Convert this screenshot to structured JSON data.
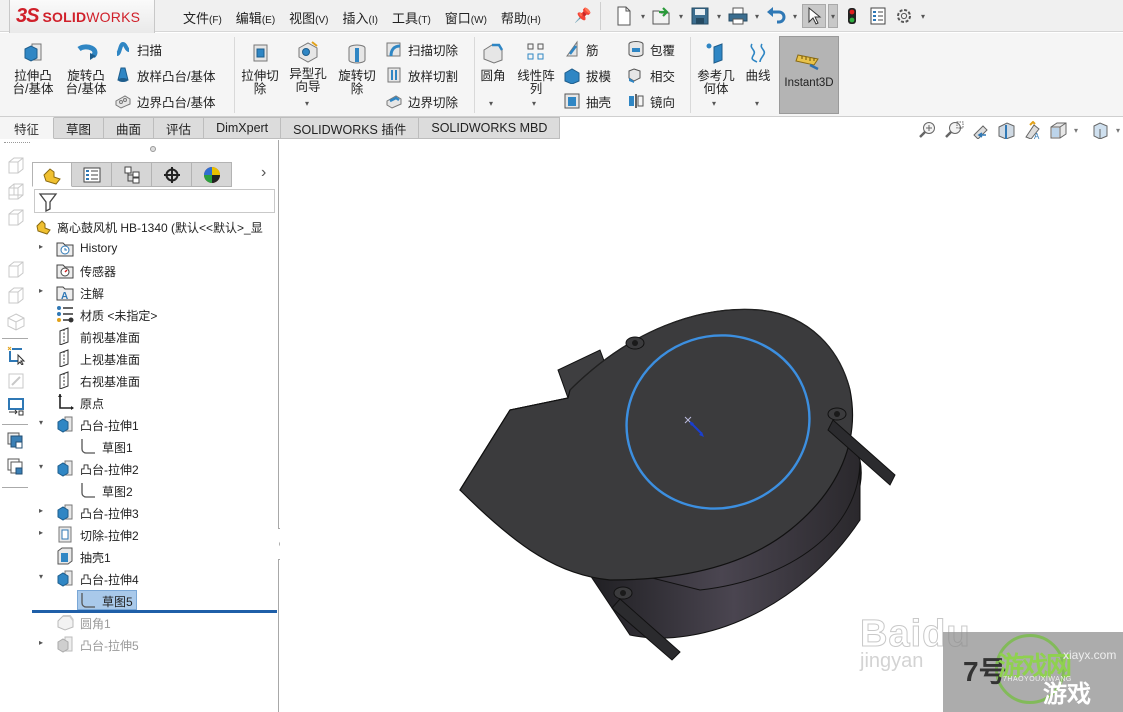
{
  "app": {
    "brand_mark": "3S",
    "brand_solid": "SOLID",
    "brand_works": "WORKS"
  },
  "menus": [
    {
      "label": "文件",
      "key": "(F)"
    },
    {
      "label": "编辑",
      "key": "(E)"
    },
    {
      "label": "视图",
      "key": "(V)"
    },
    {
      "label": "插入",
      "key": "(I)"
    },
    {
      "label": "工具",
      "key": "(T)"
    },
    {
      "label": "窗口",
      "key": "(W)"
    },
    {
      "label": "帮助",
      "key": "(H)"
    }
  ],
  "quick_access": [
    "new-document",
    "open",
    "save",
    "print",
    "undo",
    "select",
    "rebuild",
    "file-properties",
    "options"
  ],
  "commands": {
    "extrude_boss": [
      "拉伸凸",
      "台/基体"
    ],
    "revolve_boss": [
      "旋转凸",
      "台/基体"
    ],
    "sweep": "扫描",
    "loft_boss": "放样凸台/基体",
    "boundary_boss": "边界凸台/基体",
    "extrude_cut": [
      "拉伸切",
      "除"
    ],
    "hole_wizard": [
      "异型孔",
      "向导"
    ],
    "revolve_cut": [
      "旋转切",
      "除"
    ],
    "sweep_cut": "扫描切除",
    "loft_cut": "放样切割",
    "boundary_cut": "边界切除",
    "fillet": "圆角",
    "linear_pattern": [
      "线性阵",
      "列"
    ],
    "rib": "筋",
    "draft": "拔模",
    "shell": "抽壳",
    "wrap": "包覆",
    "intersect": "相交",
    "mirror": "镜向",
    "ref_geometry": [
      "参考几",
      "何体"
    ],
    "curves": "曲线",
    "instant3d": "Instant3D"
  },
  "tabs": [
    {
      "label": "特征",
      "active": true
    },
    {
      "label": "草图",
      "active": false
    },
    {
      "label": "曲面",
      "active": false
    },
    {
      "label": "评估",
      "active": false
    },
    {
      "label": "DimXpert",
      "active": false
    },
    {
      "label": "SOLIDWORKS 插件",
      "active": false
    },
    {
      "label": "SOLIDWORKS MBD",
      "active": false
    }
  ],
  "tree": {
    "root": "离心鼓风机 HB-1340  (默认<<默认>_显",
    "items": [
      {
        "label": "History",
        "expander": "collapsed",
        "icon": "history-folder"
      },
      {
        "label": "传感器",
        "expander": "none",
        "icon": "sensor-folder"
      },
      {
        "label": "注解",
        "expander": "collapsed",
        "icon": "annotation-folder"
      },
      {
        "label": "材质 <未指定>",
        "expander": "none",
        "icon": "material"
      },
      {
        "label": "前视基准面",
        "expander": "none",
        "icon": "plane"
      },
      {
        "label": "上视基准面",
        "expander": "none",
        "icon": "plane"
      },
      {
        "label": "右视基准面",
        "expander": "none",
        "icon": "plane"
      },
      {
        "label": "原点",
        "expander": "none",
        "icon": "origin"
      },
      {
        "label": "凸台-拉伸1",
        "expander": "expanded",
        "icon": "boss-extrude"
      },
      {
        "label": "草图1",
        "expander": "none",
        "icon": "sketch",
        "child": true
      },
      {
        "label": "凸台-拉伸2",
        "expander": "expanded",
        "icon": "boss-extrude"
      },
      {
        "label": "草图2",
        "expander": "none",
        "icon": "sketch",
        "child": true
      },
      {
        "label": "凸台-拉伸3",
        "expander": "collapsed",
        "icon": "boss-extrude"
      },
      {
        "label": "切除-拉伸2",
        "expander": "collapsed",
        "icon": "cut-extrude"
      },
      {
        "label": "抽壳1",
        "expander": "none",
        "icon": "shell"
      },
      {
        "label": "凸台-拉伸4",
        "expander": "expanded",
        "icon": "boss-extrude"
      },
      {
        "label": "草图5",
        "expander": "none",
        "icon": "sketch",
        "child": true,
        "selected": true
      },
      {
        "label": "圆角1",
        "expander": "none",
        "icon": "fillet",
        "suppressed": true
      },
      {
        "label": "凸台-拉伸5",
        "expander": "collapsed",
        "icon": "boss-extrude",
        "suppressed": true
      }
    ]
  },
  "watermarks": {
    "baidu": "Baidu",
    "baidu_sub": "jingyan",
    "game_num": "7号",
    "game_name": "游戏网",
    "game_url": "xiayx.com",
    "game_pinyin": "7HAOYOUXIWANG",
    "game_tail": "游戏"
  },
  "colors": {
    "brand_red": "#d0202a",
    "selection": "#a9c9ea",
    "rollback_bar": "#1f5fa8",
    "sketch_circle": "#3c8fe0",
    "model_body": "#3b3b3d"
  }
}
